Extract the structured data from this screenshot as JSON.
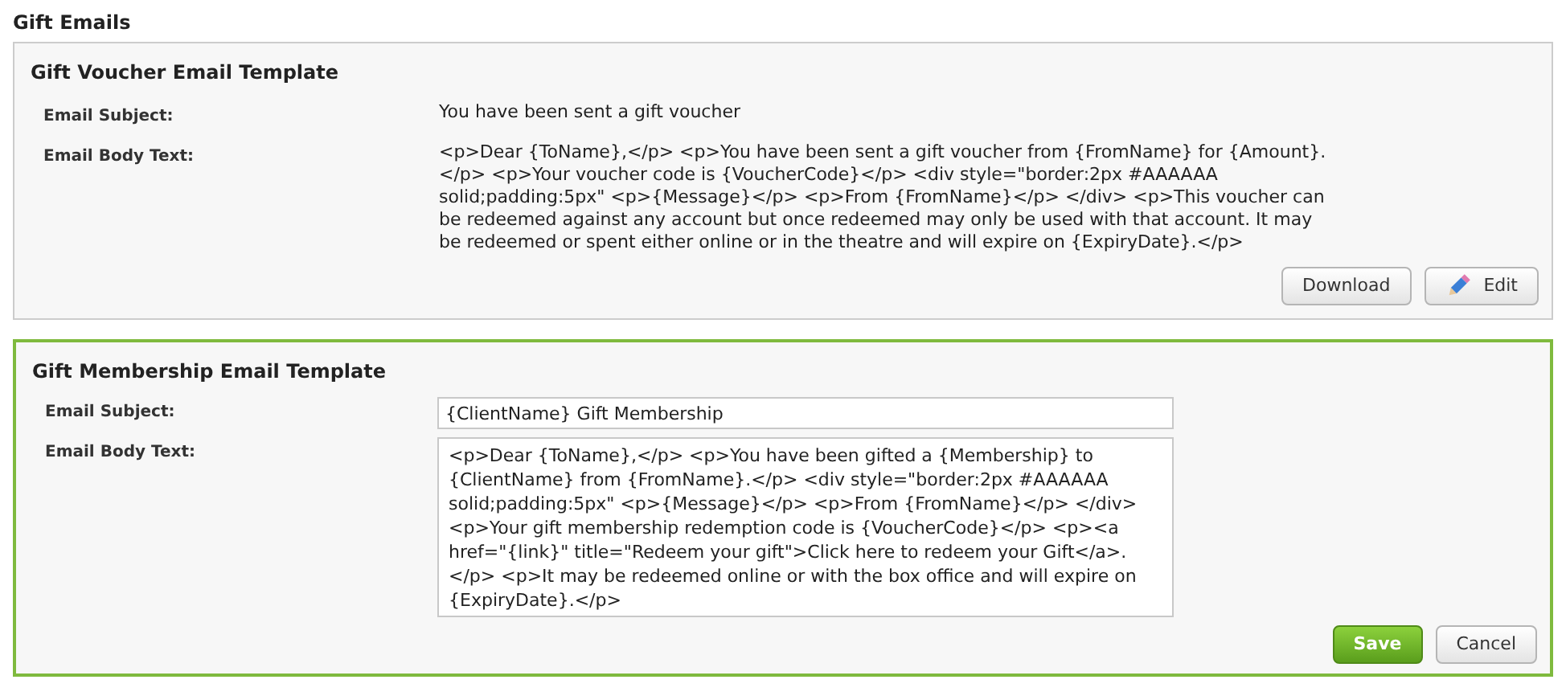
{
  "page_title": "Gift Emails",
  "templates": [
    {
      "title": "Gift Voucher Email Template",
      "kind": "view",
      "fields": [
        {
          "label": "Email Subject:",
          "value": "You have been sent a gift voucher",
          "kind": "line"
        },
        {
          "label": "Email Body Text:",
          "value": "<p>Dear {ToName},</p> <p>You have been sent a gift voucher from {FromName} for {Amount}.</p> <p>Your voucher code is {VoucherCode}</p> <div style=\"border:2px #AAAAAA solid;padding:5px\" <p>{Message}</p> <p>From {FromName}</p> </div> <p>This voucher can be redeemed against any account but once redeemed may only be used with that account. It may be redeemed or spent either online or in the theatre and will expire on {ExpiryDate}.</p>",
          "kind": "area"
        }
      ],
      "buttons": [
        {
          "label": "Download",
          "kind": "plain"
        },
        {
          "label": "Edit",
          "kind": "edit"
        }
      ]
    },
    {
      "title": "Gift Membership Email Template",
      "kind": "edit",
      "fields": [
        {
          "label": "Email Subject:",
          "value": "{ClientName} Gift Membership",
          "kind": "line"
        },
        {
          "label": "Email Body Text:",
          "value": "<p>Dear {ToName},</p> <p>You have been gifted a {Membership} to {ClientName} from {FromName}.</p> <div style=\"border:2px #AAAAAA solid;padding:5px\" <p>{Message}</p> <p>From {FromName}</p> </div> <p>Your gift membership redemption code is {VoucherCode}</p> <p><a href=\"{link}\" title=\"Redeem your gift\">Click here to redeem your Gift</a>. </p> <p>It may be redeemed online or with the box office and will expire on {ExpiryDate}.</p>",
          "kind": "area"
        }
      ],
      "buttons": [
        {
          "label": "Save",
          "kind": "primary"
        },
        {
          "label": "Cancel",
          "kind": "plain"
        }
      ]
    }
  ]
}
